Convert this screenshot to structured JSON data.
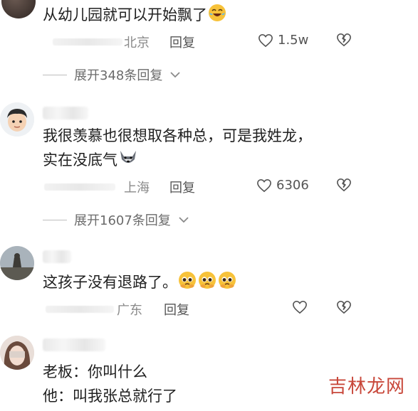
{
  "comments": [
    {
      "text": "从幼儿园就可以开始飘了",
      "emoji": "rofl-emoji",
      "location": "北京",
      "reply_label": "回复",
      "likes": "1.5w",
      "expand": "展开348条回复"
    },
    {
      "text_line1": "我很羡慕也很想取各种总，可是我姓龙，",
      "text_line2": "实在没底气",
      "emoji": "husky-emoji",
      "location": "上海",
      "reply_label": "回复",
      "likes": "6306",
      "expand": "展开1607条回复"
    },
    {
      "text": "这孩子没有退路了。",
      "emoji": "pleading-emoji",
      "location": "广东",
      "reply_label": "回复",
      "likes": ""
    },
    {
      "text_line1": "老板：你叫什么",
      "text_line2": "他：叫我张总就行了"
    }
  ],
  "watermark": "吉林龙网",
  "colors": {
    "accent_watermark": "#c8473a",
    "meta_gray": "#8a8a8a"
  }
}
